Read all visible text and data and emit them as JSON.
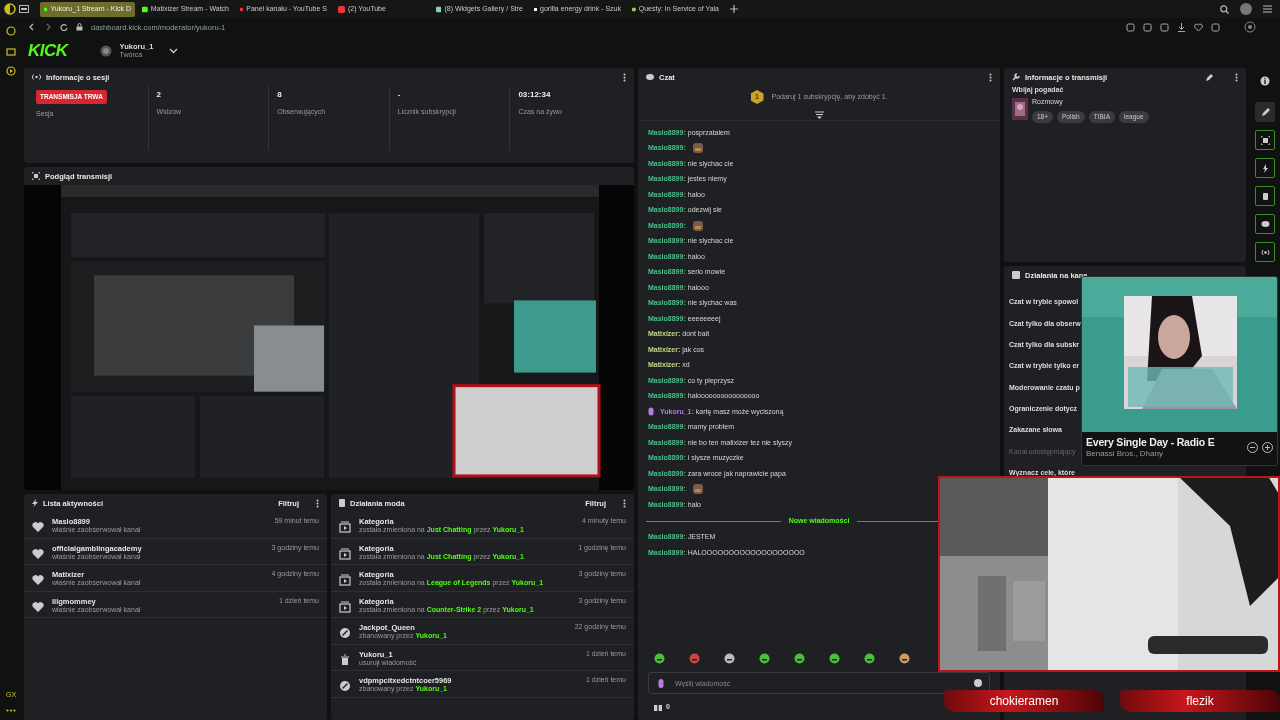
{
  "browser": {
    "tabs": [
      {
        "label": "Yukoru_1 Stream - Kick D",
        "selected": true
      },
      {
        "label": "Matixizer Stream - Watch",
        "selected": false
      },
      {
        "label": "Panel kanału - YouTube S",
        "selected": false
      },
      {
        "label": "(2) YouTube",
        "selected": false
      },
      {
        "label": "(8) Widgets Gallery / Stre",
        "selected": false
      },
      {
        "label": "gorilla energy drink - Szuk",
        "selected": false
      },
      {
        "label": "Questy: In Service of Yala",
        "selected": false
      }
    ],
    "url": "dashboard.kick.com/moderator/yukoru-1",
    "sidebar_label": "GX"
  },
  "header": {
    "logo": "KICK",
    "channel": "Yukoru_1",
    "role": "Twórca"
  },
  "session": {
    "title": "Informacje o sesji",
    "stats": [
      {
        "kind": "badge",
        "value": "TRANSMISJA TRWA",
        "label": "Sesja"
      },
      {
        "kind": "text",
        "value": "2",
        "label": "Widzów"
      },
      {
        "kind": "text",
        "value": "8",
        "label": "Obserwujących"
      },
      {
        "kind": "text",
        "value": "-",
        "label": "Licznik subskrypcji"
      },
      {
        "kind": "text",
        "value": "03:12:34",
        "label": "Czas na żywo"
      }
    ]
  },
  "preview": {
    "title": "Podgląd transmisji"
  },
  "activity": {
    "title": "Lista aktywności",
    "filter": "Filtruj",
    "items": [
      {
        "name": "Maslo8899",
        "detail": "właśnie zaobserwował kanał",
        "time": "59 minut temu"
      },
      {
        "name": "officialgamblingacademy",
        "detail": "właśnie zaobserwował kanał",
        "time": "3 godziny temu"
      },
      {
        "name": "Matixizer",
        "detail": "właśnie zaobserwował kanał",
        "time": "4 godziny temu"
      },
      {
        "name": "lilgmommey",
        "detail": "właśnie zaobserwował kanał",
        "time": "1 dzień temu"
      }
    ]
  },
  "mod_actions": {
    "title": "Działania moda",
    "filter": "Filtruj",
    "items": [
      {
        "kind": "category",
        "title": "Kategoria",
        "time": "4 minuty temu",
        "detail": [
          {
            "kind": "plain",
            "text": "została zmieniona na"
          },
          {
            "kind": "link",
            "text": "Just Chatting"
          },
          {
            "kind": "plain",
            "text": "przez"
          },
          {
            "kind": "link",
            "text": "Yukoru_1"
          }
        ]
      },
      {
        "kind": "category",
        "title": "Kategoria",
        "time": "1 godzinę temu",
        "detail": [
          {
            "kind": "plain",
            "text": "została zmieniona na"
          },
          {
            "kind": "link",
            "text": "Just Chatting"
          },
          {
            "kind": "plain",
            "text": "przez"
          },
          {
            "kind": "link",
            "text": "Yukoru_1"
          }
        ]
      },
      {
        "kind": "category",
        "title": "Kategoria",
        "time": "3 godziny temu",
        "detail": [
          {
            "kind": "plain",
            "text": "została zmieniona na"
          },
          {
            "kind": "link",
            "text": "League of Legends"
          },
          {
            "kind": "plain",
            "text": "przez"
          },
          {
            "kind": "link",
            "text": "Yukoru_1"
          }
        ]
      },
      {
        "kind": "category",
        "title": "Kategoria",
        "time": "3 godziny temu",
        "detail": [
          {
            "kind": "plain",
            "text": "została zmieniona na"
          },
          {
            "kind": "link",
            "text": "Counter-Strike 2"
          },
          {
            "kind": "plain",
            "text": "przez"
          },
          {
            "kind": "link",
            "text": "Yukoru_1"
          }
        ]
      },
      {
        "kind": "ban",
        "title": "Jackpot_Queen",
        "time": "22 godziny temu",
        "detail": [
          {
            "kind": "plain",
            "text": "zbanowany przez"
          },
          {
            "kind": "link",
            "text": "Yukoru_1"
          }
        ]
      },
      {
        "kind": "delete",
        "title": "Yukoru_1",
        "time": "1 dzień temu",
        "detail": [
          {
            "kind": "plain",
            "text": "usunął wiadomość"
          }
        ]
      },
      {
        "kind": "ban",
        "title": "vdpmpcitxedctntcoer5969",
        "time": "1 dzień temu",
        "detail": [
          {
            "kind": "plain",
            "text": "zbanowany przez"
          },
          {
            "kind": "link",
            "text": "Yukoru_1"
          }
        ]
      }
    ]
  },
  "chat": {
    "title": "Czat",
    "promo_count": "1",
    "promo": "Podaruj 1 subskrypcję, aby zdobyć 1.",
    "messages": [
      {
        "user": "Maslo8899:",
        "color": "#4cbf8a",
        "badge": false,
        "kind": "text",
        "text": "posprzatalem"
      },
      {
        "user": "Maslo8899:",
        "color": "#4cbf8a",
        "badge": false,
        "kind": "emote"
      },
      {
        "user": "Maslo8899:",
        "color": "#4cbf8a",
        "badge": false,
        "kind": "text",
        "text": "nie slychac cie"
      },
      {
        "user": "Maslo8899:",
        "color": "#4cbf8a",
        "badge": false,
        "kind": "text",
        "text": "jestes niemy"
      },
      {
        "user": "Maslo8899:",
        "color": "#4cbf8a",
        "badge": false,
        "kind": "text",
        "text": "haloo"
      },
      {
        "user": "Maslo8899:",
        "color": "#4cbf8a",
        "badge": false,
        "kind": "text",
        "text": "odezwij sie"
      },
      {
        "user": "Maslo8899:",
        "color": "#4cbf8a",
        "badge": false,
        "kind": "emote"
      },
      {
        "user": "Maslo8899:",
        "color": "#4cbf8a",
        "badge": false,
        "kind": "text",
        "text": "nie slychac cie"
      },
      {
        "user": "Maslo8899:",
        "color": "#4cbf8a",
        "badge": false,
        "kind": "text",
        "text": "haloo"
      },
      {
        "user": "Maslo8899:",
        "color": "#4cbf8a",
        "badge": false,
        "kind": "text",
        "text": "serio mowie"
      },
      {
        "user": "Maslo8899:",
        "color": "#4cbf8a",
        "badge": false,
        "kind": "text",
        "text": "halooo"
      },
      {
        "user": "Maslo8899:",
        "color": "#4cbf8a",
        "badge": false,
        "kind": "text",
        "text": "nie slychac was"
      },
      {
        "user": "Maslo8899:",
        "color": "#4cbf8a",
        "badge": false,
        "kind": "text",
        "text": "eeeeeeeej"
      },
      {
        "user": "Matixizer:",
        "color": "#c5d88a",
        "badge": false,
        "kind": "text",
        "text": "dont bait"
      },
      {
        "user": "Matixizer:",
        "color": "#c5d88a",
        "badge": false,
        "kind": "text",
        "text": "jak cos"
      },
      {
        "user": "Matixizer:",
        "color": "#c5d88a",
        "badge": false,
        "kind": "text",
        "text": "xd"
      },
      {
        "user": "Maslo8899:",
        "color": "#4cbf8a",
        "badge": false,
        "kind": "text",
        "text": "co ty pieprzysz"
      },
      {
        "user": "Maslo8899:",
        "color": "#4cbf8a",
        "badge": false,
        "kind": "text",
        "text": "haloooooooooooooooo"
      },
      {
        "user": "Yukoru_1:",
        "color": "#b77be0",
        "badge": true,
        "kind": "text",
        "text": "kartę masz może wyciszoną"
      },
      {
        "user": "Maslo8899:",
        "color": "#4cbf8a",
        "badge": false,
        "kind": "text",
        "text": "mamy problem"
      },
      {
        "user": "Maslo8899:",
        "color": "#4cbf8a",
        "badge": false,
        "kind": "text",
        "text": "nie bo ten matixizer tez nie slyszy"
      },
      {
        "user": "Maslo8899:",
        "color": "#4cbf8a",
        "badge": false,
        "kind": "text",
        "text": "i slysze muzyczke"
      },
      {
        "user": "Maslo8899:",
        "color": "#4cbf8a",
        "badge": false,
        "kind": "text",
        "text": "zara wroce jak naprawicie papa"
      },
      {
        "user": "Maslo8899:",
        "color": "#4cbf8a",
        "badge": false,
        "kind": "emote"
      },
      {
        "user": "Maslo8899:",
        "color": "#4cbf8a",
        "badge": false,
        "kind": "text",
        "text": "halo"
      }
    ],
    "divider": "Nowe wiadomości",
    "new_messages": [
      {
        "user": "Maslo8899:",
        "color": "#4cbf8a",
        "badge": false,
        "kind": "text",
        "text": "JESTEM"
      },
      {
        "user": "Maslo8899:",
        "color": "#4cbf8a",
        "badge": false,
        "kind": "text",
        "text": "HALOOOOOOOOOOOOOOOOOOO"
      }
    ],
    "placeholder": "Wyślij wiadomość",
    "gift_count": "0"
  },
  "stream_info": {
    "title": "Informacje o transmisji",
    "stream_title": "Wbijaj pogadać",
    "category": "Rozmowy",
    "tags": [
      "18+",
      "Polish",
      "TIBIA",
      "league"
    ]
  },
  "channel_actions": {
    "title": "Działania na kana",
    "items": [
      {
        "label": "Czat w trybie spowol",
        "disabled": false
      },
      {
        "label": "Czat tylko dla obserw",
        "disabled": false
      },
      {
        "label": "Czat tylko dla subskr",
        "disabled": false
      },
      {
        "label": "Czat w trybie tylko er",
        "disabled": false
      },
      {
        "label": "Moderowanie czatu p",
        "disabled": false
      },
      {
        "label": "Ograniczenie dotycz",
        "disabled": false
      },
      {
        "label": "Zakazane słowa",
        "disabled": false
      },
      {
        "label": "Kanał udostępniający",
        "disabled": true
      },
      {
        "label": "Wyznacz cele, które",
        "disabled": false
      }
    ]
  },
  "music_player": {
    "title": "Every Single Day - Radio E",
    "artist": "Benassi Bros., Dhany"
  },
  "stream_overlay": {
    "names": [
      "chokieramen",
      "flezik"
    ]
  }
}
